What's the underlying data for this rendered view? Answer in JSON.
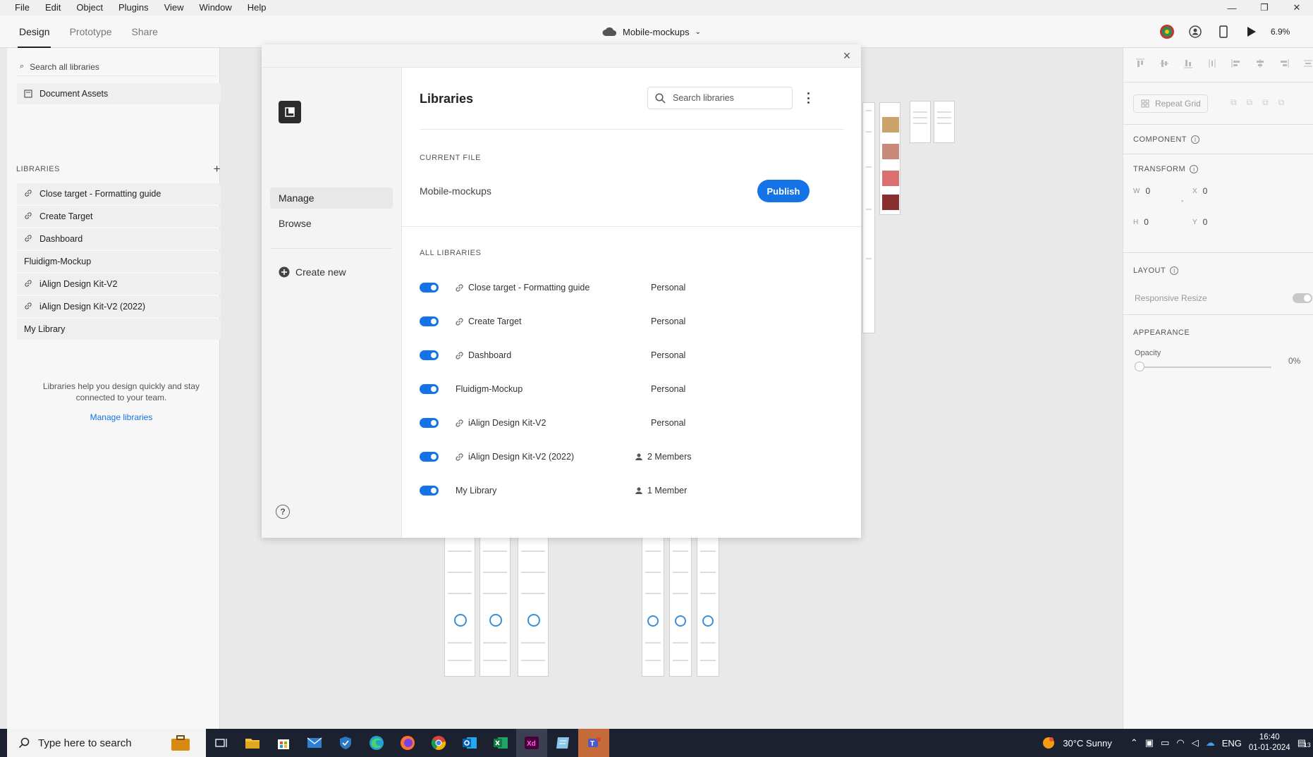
{
  "menubar": {
    "items": [
      "File",
      "Edit",
      "Object",
      "Plugins",
      "View",
      "Window",
      "Help"
    ]
  },
  "toolbar": {
    "tabs": [
      "Design",
      "Prototype",
      "Share"
    ],
    "doc_title": "Mobile-mockups",
    "zoom": "6.9%"
  },
  "left_panel": {
    "search_placeholder": "Search all libraries",
    "document_assets": "Document Assets",
    "section_label": "LIBRARIES",
    "libraries": [
      "Close target - Formatting guide",
      "Create Target",
      "Dashboard",
      "Fluidigm-Mockup",
      "iAlign Design Kit-V2",
      "iAlign Design Kit-V2 (2022)",
      "My Library"
    ],
    "help_text": "Libraries help you design quickly and stay connected to your team.",
    "manage_link": "Manage libraries"
  },
  "right_panel": {
    "repeat_grid": "Repeat Grid",
    "component_label": "COMPONENT",
    "transform_label": "TRANSFORM",
    "w_label": "W",
    "w_value": "0",
    "x_label": "X",
    "x_value": "0",
    "h_label": "H",
    "h_value": "0",
    "y_label": "Y",
    "y_value": "0",
    "layout_label": "LAYOUT",
    "responsive_resize": "Responsive Resize",
    "appearance_label": "APPEARANCE",
    "opacity_label": "Opacity",
    "opacity_value": "0%"
  },
  "modal": {
    "title": "Libraries",
    "search_placeholder": "Search libraries",
    "nav": [
      "Manage",
      "Browse"
    ],
    "create_new": "Create new",
    "current_file_label": "CURRENT FILE",
    "current_file": "Mobile-mockups",
    "publish": "Publish",
    "all_libraries_label": "ALL LIBRARIES",
    "libraries": [
      {
        "name": "Close target - Formatting guide",
        "owner": "Personal",
        "linked": true,
        "enabled": true
      },
      {
        "name": "Create Target",
        "owner": "Personal",
        "linked": true,
        "enabled": true
      },
      {
        "name": "Dashboard",
        "owner": "Personal",
        "linked": true,
        "enabled": true
      },
      {
        "name": "Fluidigm-Mockup",
        "owner": "Personal",
        "linked": false,
        "enabled": true
      },
      {
        "name": "iAlign Design Kit-V2",
        "owner": "Personal",
        "linked": true,
        "enabled": true
      },
      {
        "name": "iAlign Design Kit-V2 (2022)",
        "owner": "2 Members",
        "linked": true,
        "enabled": true
      },
      {
        "name": "My Library",
        "owner": "1 Member",
        "linked": false,
        "enabled": true
      }
    ]
  },
  "taskbar": {
    "search_placeholder": "Type here to search",
    "weather": "30°C  Sunny",
    "language": "ENG",
    "time": "16:40",
    "date": "01-01-2024",
    "notif_badge": "13"
  },
  "colors": {
    "accent": "#1473e6",
    "taskbar": "#1c2130"
  }
}
